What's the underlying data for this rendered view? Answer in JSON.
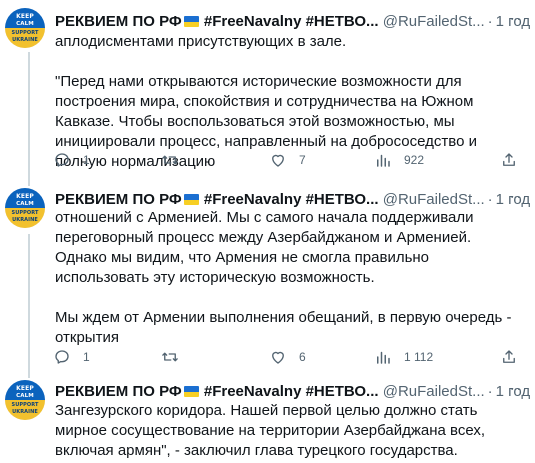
{
  "avatar": {
    "line1": "KEEP",
    "line2": "CALM",
    "line3": "SUPPORT",
    "line4": "UKRAINE"
  },
  "account": {
    "name": "РЕКВИЕМ ПО РФ",
    "name_suffix": "#FreeNavalny #НЕТВО...",
    "handle": "@RuFailedSt...",
    "separator": "·",
    "more": "···"
  },
  "tweets": [
    {
      "time": "1 год",
      "text": "аплодисментами присутствующих в зале.\n\n\"Перед нами открываются исторические возможности для построения мира, спокойствия и сотрудничества на Южном Кавказе. Чтобы воспользоваться этой возможностью, мы инициировали процесс, направленный на добрососедство и полную нормализацию",
      "replies": "1",
      "retweets": "",
      "likes": "7",
      "views": "922"
    },
    {
      "time": "1 год",
      "text": "отношений с Арменией. Мы с самого начала поддерживали переговорный процесс между Азербайджаном и Арменией. Однако мы видим, что Армения не смогла правильно использовать эту историческую возможность.\n\nМы ждем от Армении выполнения обещаний, в первую очередь - открытия",
      "replies": "1",
      "retweets": "",
      "likes": "6",
      "views": "1 112"
    },
    {
      "time": "1 год",
      "text": "Зангезурского коридора. Нашей первой целью должно стать мирное сосуществование на территории Азербайджана всех, включая армян\", - заключил глава турецкого государства."
    }
  ],
  "colors": {
    "text": "#0f1419",
    "secondary": "#536471",
    "divider": "#eff3f4",
    "thread_line": "#cfd9de"
  },
  "icons": [
    "reply-icon",
    "retweet-icon",
    "like-icon",
    "views-icon",
    "share-icon",
    "more-icon"
  ]
}
